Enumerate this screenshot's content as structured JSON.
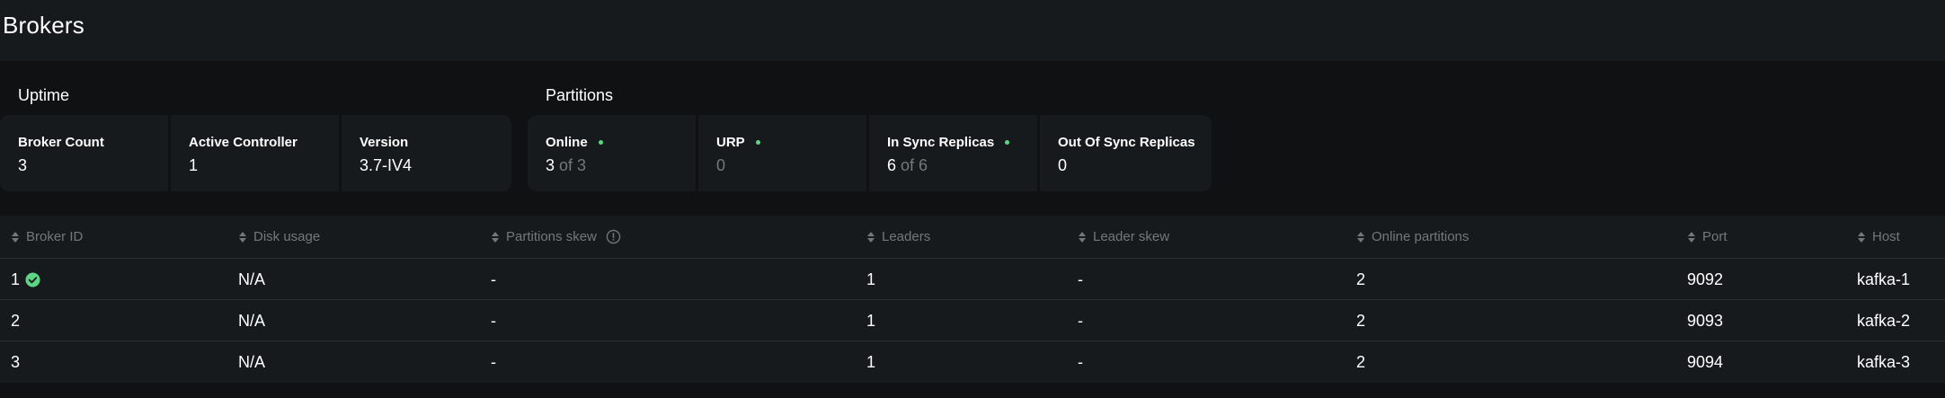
{
  "header": {
    "title": "Brokers"
  },
  "uptime": {
    "label": "Uptime",
    "cards": [
      {
        "label": "Broker Count",
        "value": "3"
      },
      {
        "label": "Active Controller",
        "value": "1"
      },
      {
        "label": "Version",
        "value": "3.7-IV4"
      }
    ]
  },
  "partitions": {
    "label": "Partitions",
    "cards": [
      {
        "label": "Online",
        "value": "3",
        "suffix": "of 3",
        "status": "ok"
      },
      {
        "label": "URP",
        "value": "0",
        "status": "ok"
      },
      {
        "label": "In Sync Replicas",
        "value": "6",
        "suffix": "of 6",
        "status": "ok"
      },
      {
        "label": "Out Of Sync Replicas",
        "value": "0"
      }
    ]
  },
  "table": {
    "columns": [
      "Broker ID",
      "Disk usage",
      "Partitions skew",
      "Leaders",
      "Leader skew",
      "Online partitions",
      "Port",
      "Host"
    ],
    "rows": [
      {
        "broker_id": "1",
        "controller": true,
        "disk_usage": "N/A",
        "partitions_skew": "-",
        "leaders": "1",
        "leader_skew": "-",
        "online_partitions": "2",
        "port": "9092",
        "host": "kafka-1"
      },
      {
        "broker_id": "2",
        "controller": false,
        "disk_usage": "N/A",
        "partitions_skew": "-",
        "leaders": "1",
        "leader_skew": "-",
        "online_partitions": "2",
        "port": "9093",
        "host": "kafka-2"
      },
      {
        "broker_id": "3",
        "controller": false,
        "disk_usage": "N/A",
        "partitions_skew": "-",
        "leaders": "1",
        "leader_skew": "-",
        "online_partitions": "2",
        "port": "9094",
        "host": "kafka-3"
      }
    ]
  },
  "colors": {
    "status_ok": "#5cd685",
    "background": "#101112",
    "surface": "#171a1c",
    "muted_text": "#73787e"
  },
  "icons": {
    "sort": "sort-icon",
    "info": "info-icon",
    "controller": "check-circle-icon"
  }
}
